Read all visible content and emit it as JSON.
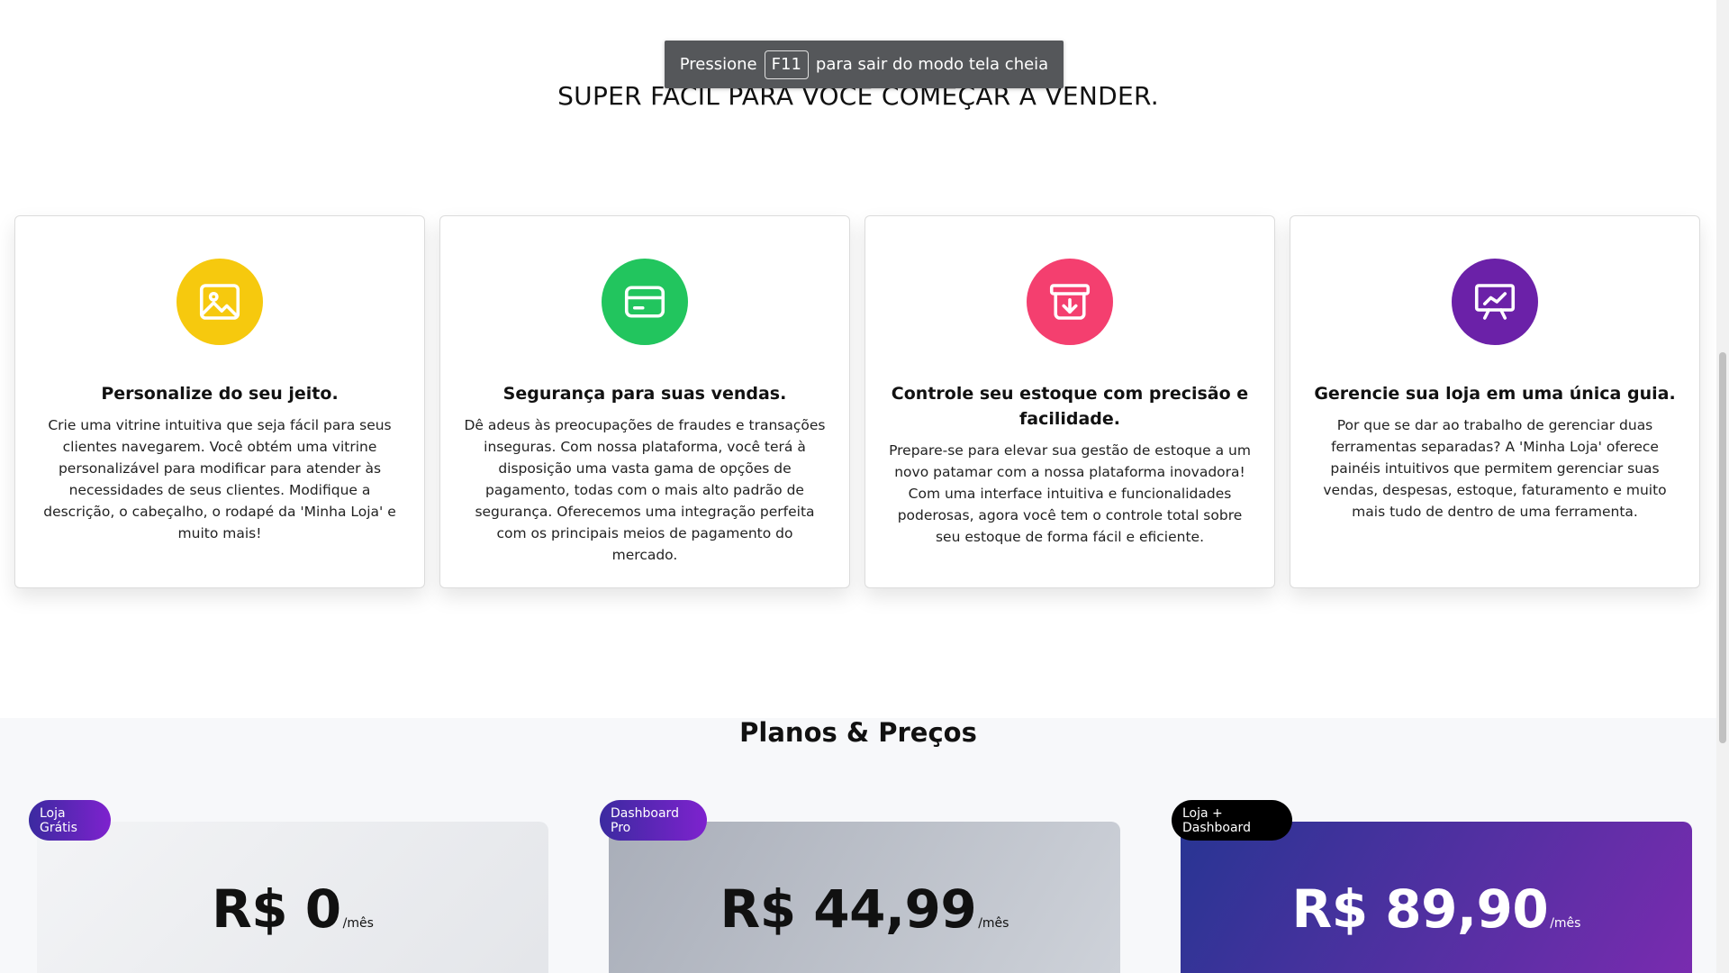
{
  "fullscreen_notice": {
    "before": "Pressione",
    "key": "F11",
    "after": "para sair do modo tela cheia"
  },
  "hero": {
    "title": "SUPER FÁCIL PARA VOCÊ COMEÇAR A VENDER."
  },
  "features": [
    {
      "icon": "image-icon",
      "color": "#f6c90e",
      "title": "Personalize do seu jeito.",
      "text": "Crie uma vitrine intuitiva que seja fácil para seus clientes navegarem. Você obtém uma vitrine personalizável para modificar para atender às necessidades de seus clientes. Modifique a descrição, o cabeçalho, o rodapé da 'Minha Loja' e muito mais!"
    },
    {
      "icon": "credit-card-icon",
      "color": "#22c55e",
      "title": "Segurança para suas vendas.",
      "text": "Dê adeus às preocupações de fraudes e transações inseguras. Com nossa plataforma, você terá à disposição uma vasta gama de opções de pagamento, todas com o mais alto padrão de segurança. Oferecemos uma integração perfeita com os principais meios de pagamento do mercado."
    },
    {
      "icon": "archive-download-icon",
      "color": "#f43f6f",
      "title": "Controle seu estoque com precisão e facilidade.",
      "text": "Prepare-se para elevar sua gestão de estoque a um novo patamar com a nossa plataforma inovadora! Com uma interface intuitiva e funcionalidades poderosas, agora você tem o controle total sobre seu estoque de forma fácil e eficiente."
    },
    {
      "icon": "presentation-chart-icon",
      "color": "#6b21a8",
      "title": "Gerencie sua loja em uma única guia.",
      "text": "Por que se dar ao trabalho de gerenciar duas ferramentas separadas? A 'Minha Loja' oferece painéis intuitivos que permitem gerenciar suas vendas, despesas, estoque, faturamento e muito mais tudo de dentro de uma ferramenta."
    }
  ],
  "pricing": {
    "title": "Planos & Preços",
    "plans": [
      {
        "badge": "Loja Grátis",
        "price": "R$ 0",
        "period": "/mês"
      },
      {
        "badge": "Dashboard Pro",
        "price": "R$ 44,99",
        "period": "/mês"
      },
      {
        "badge": "Loja + Dashboard",
        "price": "R$ 89,90",
        "period": "/mês"
      }
    ]
  }
}
